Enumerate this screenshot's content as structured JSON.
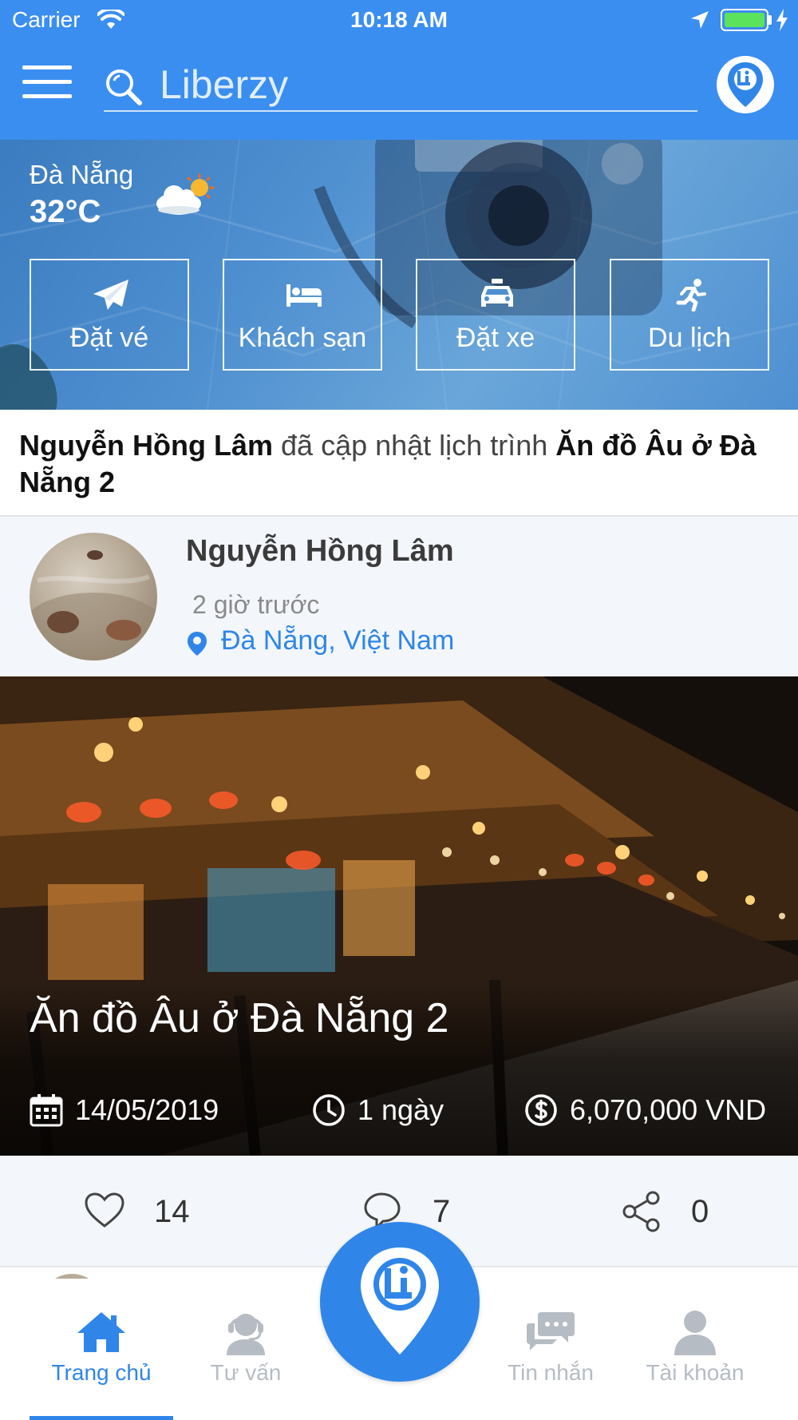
{
  "status_bar": {
    "carrier": "Carrier",
    "time": "10:18 AM"
  },
  "header": {
    "search_placeholder": "Liberzy"
  },
  "weather": {
    "city": "Đà Nẵng",
    "temperature": "32°C",
    "icon": "partly-cloudy-icon"
  },
  "services": [
    {
      "label": "Đặt vé",
      "icon": "paper-plane-icon"
    },
    {
      "label": "Khách sạn",
      "icon": "bed-icon"
    },
    {
      "label": "Đặt xe",
      "icon": "taxi-icon"
    },
    {
      "label": "Du lịch",
      "icon": "running-person-icon"
    }
  ],
  "activity": {
    "actor": "Nguyễn Hồng Lâm",
    "action": " đã cập nhật lịch trình ",
    "target": "Ăn đồ Âu ở Đà Nẵng 2"
  },
  "post": {
    "author": "Nguyễn Hồng Lâm",
    "time_ago": "2 giờ trước",
    "location": "Đà Nẵng, Việt Nam",
    "title": "Ăn đồ Âu ở Đà Nẵng 2",
    "date": "14/05/2019",
    "duration": "1 ngày",
    "cost": "6,070,000 VND",
    "likes": "14",
    "comments": "7",
    "shares": "0"
  },
  "tabs": [
    {
      "label": "Trang chủ",
      "icon": "home-icon",
      "active": true
    },
    {
      "label": "Tư vấn",
      "icon": "support-agent-icon",
      "active": false
    },
    {
      "label": "Tin nhắn",
      "icon": "chat-bubbles-icon",
      "active": false
    },
    {
      "label": "Tài khoản",
      "icon": "user-icon",
      "active": false
    }
  ],
  "colors": {
    "primary": "#3a8ef0",
    "accent_blue": "#2f86e8",
    "inactive_tab": "#b6bcc3",
    "card_bg": "#f3f6fa"
  }
}
